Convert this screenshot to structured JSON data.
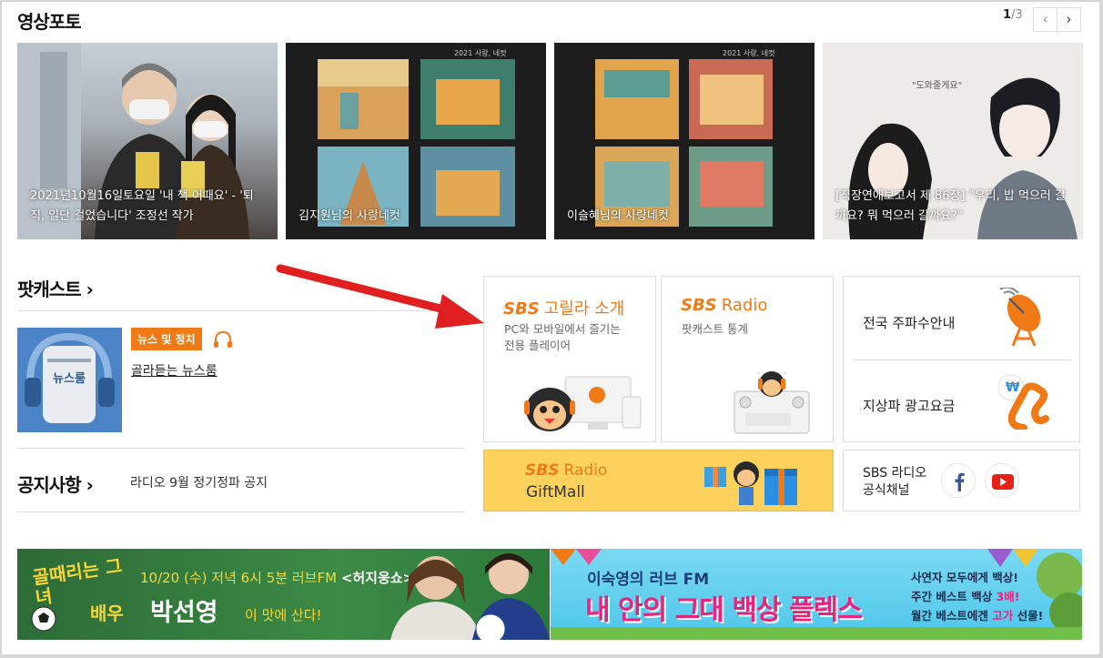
{
  "photo_section": {
    "title": "영상포토",
    "pager": {
      "current": "1",
      "total": "/3",
      "prev_glyph": "‹",
      "next_glyph": "›"
    },
    "cards": [
      {
        "caption": "2021년10월16일토요일 '내 책 어때요' - '퇴직, 일단 걸었습니다' 조정선 작가"
      },
      {
        "caption": "김지원님의 사랑네컷",
        "poster_text": "2021 사랑, 네컷"
      },
      {
        "caption": "이슬혜님의 사랑네컷",
        "poster_text": "2021 사랑, 네컷"
      },
      {
        "caption": "[직장연애보고서 제 86장] \"우리, 밥 먹으러 갈까요? 뭐 먹으러 갈까요?\"",
        "bubble_text": "\"도와줄게요\""
      }
    ]
  },
  "podcast": {
    "title": "팟캐스트",
    "arrow": "›",
    "category": "뉴스 및 정치",
    "item_title": "골라듣는 뉴스룸",
    "thumb_text": "뉴스룸"
  },
  "notice": {
    "title": "공지사항",
    "arrow": "›",
    "text": "라디오 9월 정기정파 공지"
  },
  "tiles": {
    "gorilla": {
      "brand": "SBS",
      "title": "고릴라 소개",
      "desc1": "PC와 모바일에서 즐기는",
      "desc2": "전용 플레이어"
    },
    "podcast_stats": {
      "brand": "SBS",
      "title": "Radio",
      "desc": "팟캐스트 통계"
    },
    "giftmall": {
      "brand": "SBS",
      "title": "Radio",
      "desc": "GiftMall"
    },
    "frequency": {
      "label": "전국 주파수안내"
    },
    "ad_rates": {
      "label": "지상파 광고요금",
      "won": "₩"
    },
    "official": {
      "line1": "SBS 라디오",
      "line2": "공식채널"
    }
  },
  "banners": {
    "left": {
      "logo": "골때리는 그녀",
      "line": "10/20 (수) 저녁 6시 5분 러브FM",
      "show": "<허지웅쇼>",
      "role": "배우",
      "name": "박선영",
      "tail": "이 맛에 산다!"
    },
    "right": {
      "top": "이숙영의 러브 FM",
      "main": "내 안의 그대 백상 플렉스",
      "l1": "사연자 모두에게 백상!",
      "l2a": "주간 베스트 백상 ",
      "l2b": "3배!",
      "l3a": "월간 베스트에겐 ",
      "l3b": "고가",
      "l3c": " 선물!"
    }
  },
  "colors": {
    "accent": "#f07a16",
    "arrow": "#e02020",
    "giftmall_bg": "#fcd25c",
    "banner_green": "#2c7a3a",
    "banner_sky": "#5fd0ee"
  }
}
